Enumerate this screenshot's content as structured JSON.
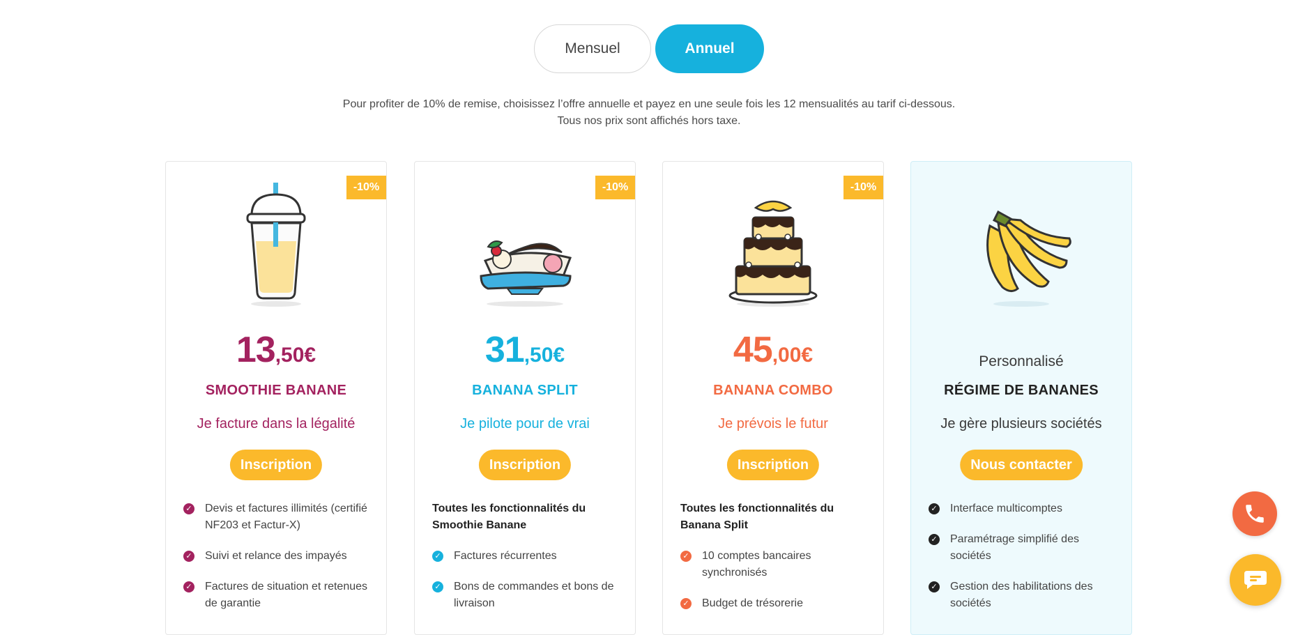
{
  "toggle": {
    "monthly_label": "Mensuel",
    "annual_label": "Annuel",
    "selected": "Annuel"
  },
  "notice": {
    "line1": "Pour profiter de 10% de remise, choisissez l’offre annuelle et payez en une seule fois les 12 mensualités au tarif ci-dessous.",
    "line2": "Tous nos prix sont affichés hors taxe."
  },
  "colors": {
    "accent_blue": "#16b1dd",
    "badge_yellow": "#fbb92b",
    "purple": "#a3225f",
    "orange": "#f26a42",
    "dark": "#222222"
  },
  "plans": [
    {
      "badge": "-10%",
      "illustration": "smoothie-cup",
      "price_int": "13",
      "price_dec": ",50€",
      "name": "SMOOTHIE BANANE",
      "tagline": "Je facture dans la légalité",
      "cta": "Inscription",
      "features": [
        "Devis et factures illimités (certifié NF203 et Factur-X)",
        "Suivi et relance des impayés",
        "Factures de situation et retenues de garantie"
      ]
    },
    {
      "badge": "-10%",
      "illustration": "banana-split",
      "price_int": "31",
      "price_dec": ",50€",
      "name": "BANANA SPLIT",
      "tagline": "Je pilote pour de vrai",
      "cta": "Inscription",
      "heading": "Toutes les fonctionnalités du Smoothie Banane",
      "features": [
        "Factures récurrentes",
        "Bons de commandes et bons de livraison"
      ]
    },
    {
      "badge": "-10%",
      "illustration": "layer-cake",
      "price_int": "45",
      "price_dec": ",00€",
      "name": "BANANA COMBO",
      "tagline": "Je prévois le futur",
      "cta": "Inscription",
      "heading": "Toutes les fonctionnalités du Banana Split",
      "features": [
        "10 comptes bancaires synchronisés",
        "Budget de trésorerie"
      ]
    },
    {
      "illustration": "banana-bunch",
      "pretitle": "Personnalisé",
      "name": "RÉGIME DE BANANES",
      "tagline": "Je gère plusieurs sociétés",
      "cta": "Nous contacter",
      "features": [
        "Interface multicomptes",
        "Paramétrage simplifié des sociétés",
        "Gestion des habilitations des sociétés"
      ]
    }
  ],
  "floating": {
    "phone_icon": "phone-icon",
    "chat_icon": "chat-icon"
  }
}
